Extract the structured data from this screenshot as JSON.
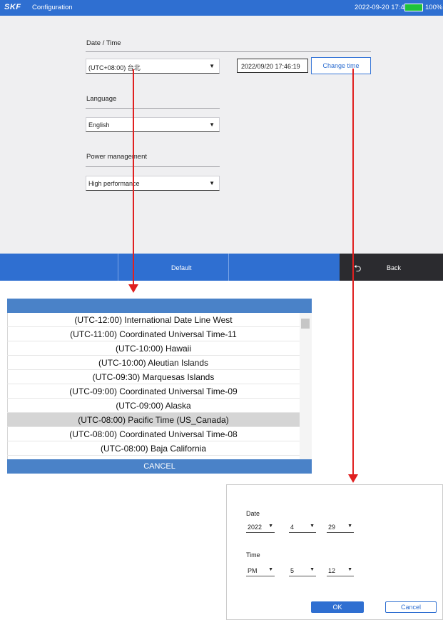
{
  "titlebar": {
    "logo": "SKF",
    "title": "Configuration",
    "datetime": "2022-09-20 17:46",
    "battery": "100%",
    "battery_level": 1.0
  },
  "config": {
    "datetime_section": "Date / Time",
    "timezone_value": "(UTC+08:00) 台北",
    "datetime_value": "2022/09/20 17:46:19",
    "change_time_label": "Change time",
    "language_section": "Language",
    "language_value": "English",
    "power_section": "Power management",
    "power_value": "High performance"
  },
  "footer": {
    "default_label": "Default",
    "back_label": "Back"
  },
  "timezone_list": {
    "items": [
      "(UTC-12:00) International Date Line West",
      "(UTC-11:00) Coordinated Universal Time-11",
      "(UTC-10:00) Hawaii",
      "(UTC-10:00) Aleutian Islands",
      "(UTC-09:30) Marquesas Islands",
      "(UTC-09:00) Coordinated Universal Time-09",
      "(UTC-09:00) Alaska",
      "(UTC-08:00) Pacific Time (US_Canada)",
      "(UTC-08:00) Coordinated Universal Time-08",
      "(UTC-08:00) Baja California"
    ],
    "selected_index": 7,
    "cancel_label": "CANCEL"
  },
  "dialog": {
    "date_label": "Date",
    "year": "2022",
    "month": "4",
    "day": "29",
    "time_label": "Time",
    "ampm": "PM",
    "hour": "5",
    "minute": "12",
    "ok_label": "OK",
    "cancel_label": "Cancel"
  },
  "colors": {
    "accent": "#2f6fd1",
    "list_header": "#4a82c8",
    "arrow": "#e02020"
  }
}
